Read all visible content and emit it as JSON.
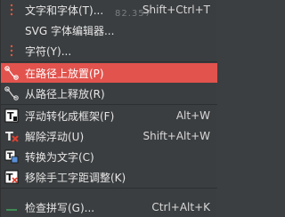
{
  "colors": {
    "background": "#3b3e40",
    "highlight": "#e2534d",
    "text": "#e6e6e6",
    "separator": "#2d2f31"
  },
  "background_snippet": "82.357",
  "menu": {
    "items": [
      {
        "label": "文字和字体(T)...",
        "shortcut": "Shift+Ctrl+T",
        "icon": "text-font-icon"
      },
      {
        "label": "SVG 字体编辑器...",
        "shortcut": "",
        "icon": ""
      },
      {
        "label": "字符(Y)...",
        "shortcut": "",
        "icon": "glyphs-icon"
      },
      {
        "label": "在路径上放置(P)",
        "shortcut": "",
        "icon": "put-on-path-icon"
      },
      {
        "label": "从路径上释放(R)",
        "shortcut": "",
        "icon": "remove-from-path-icon"
      },
      {
        "label": "浮动转化成框架(F)",
        "shortcut": "Alt+W",
        "icon": "flow-into-frame-icon"
      },
      {
        "label": "解除浮动(U)",
        "shortcut": "Shift+Alt+W",
        "icon": "unflow-icon"
      },
      {
        "label": "转换为文字(C)",
        "shortcut": "",
        "icon": "convert-to-text-icon"
      },
      {
        "label": "移除手工字距调整(K)",
        "shortcut": "",
        "icon": "remove-kerns-icon"
      },
      {
        "label": "检查拼写(G)...",
        "shortcut": "Ctrl+Alt+K",
        "icon": "spellcheck-icon"
      }
    ]
  }
}
